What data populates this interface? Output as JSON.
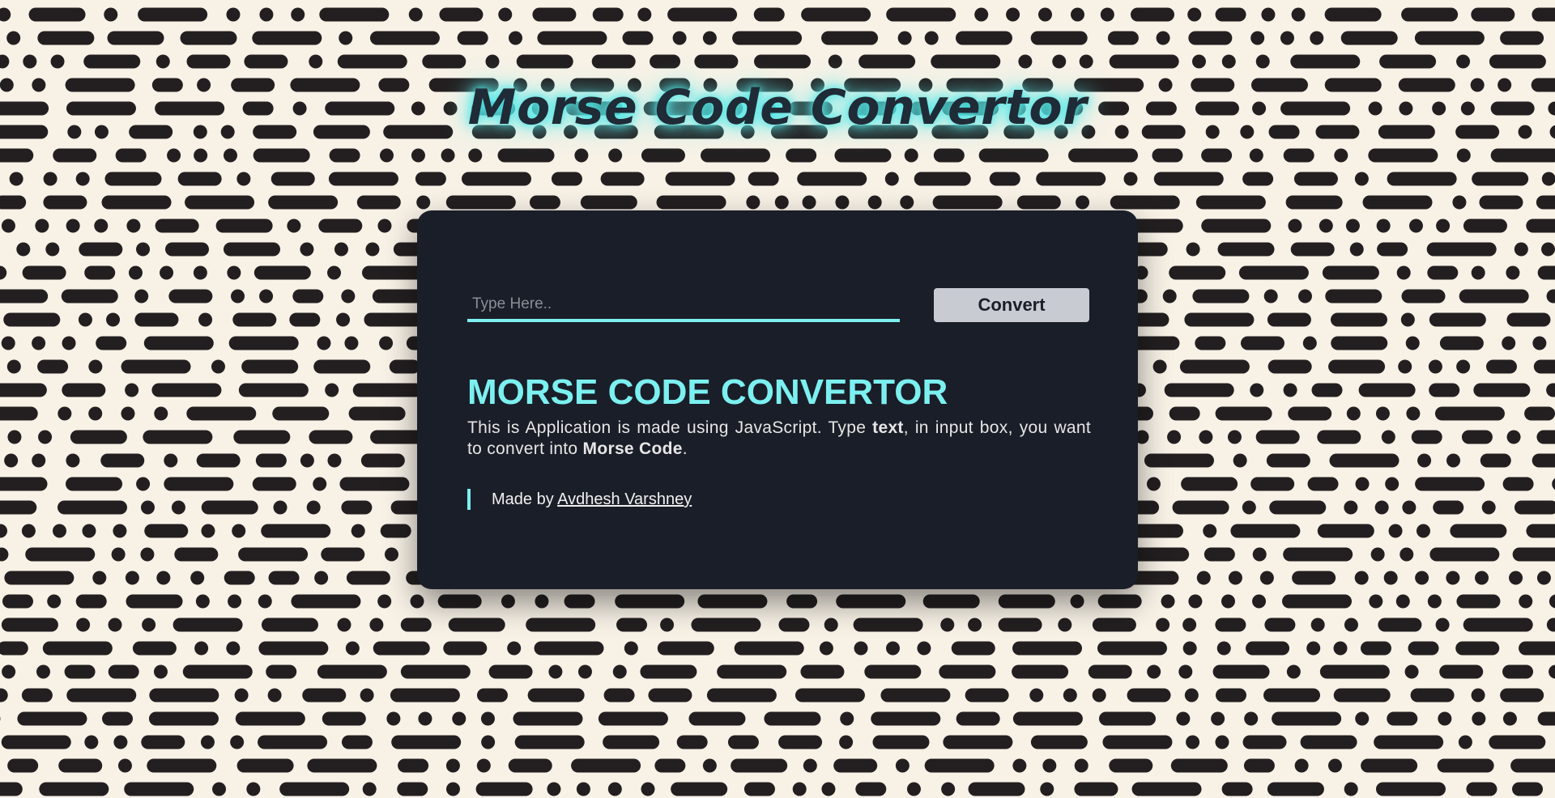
{
  "page": {
    "title": "Morse Code Convertor",
    "background_color": "#f7f1e6",
    "pattern_color": "#231f20"
  },
  "card": {
    "background_color": "#1a1e28",
    "accent_color": "#7cf0f0",
    "input": {
      "placeholder": "Type Here..",
      "value": ""
    },
    "convert_button_label": "Convert",
    "heading": "MORSE CODE CONVERTOR",
    "description": {
      "part1": "This is Application is made using JavaScript. Type ",
      "bold1": "text",
      "part2": ", in input box, you want to convert into ",
      "bold2": "Morse Code",
      "part3": "."
    },
    "credit": {
      "prefix": "Made by ",
      "author_link": "Avdhesh Varshney"
    }
  }
}
